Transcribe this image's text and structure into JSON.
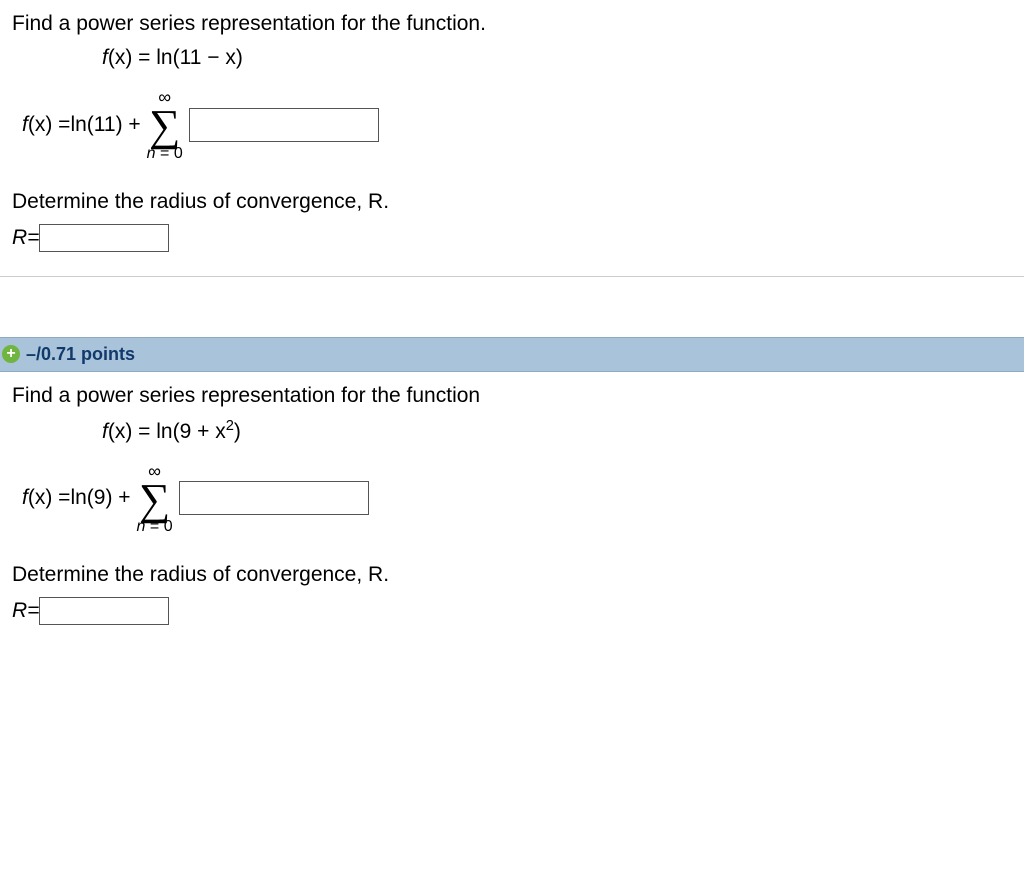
{
  "q1": {
    "prompt": "Find a power series representation for the function.",
    "fn_prefix": "f",
    "fn_arg": "(x) = ",
    "fn_body": "ln(11 − x)",
    "ans_prefix": "f",
    "ans_arg": "(x) = ",
    "ans_body": "ln(11) + ",
    "sum_top": "∞",
    "sum_bottom_var": "n",
    "sum_bottom_rest": " = 0",
    "radius_prompt": "Determine the radius of convergence, R.",
    "r_label": "R",
    "r_eq": " = "
  },
  "bar": {
    "expand": "+",
    "points": "–/0.71 points"
  },
  "q2": {
    "prompt": "Find a power series representation for the function",
    "fn_prefix": "f",
    "fn_arg": "(x) = ",
    "fn_body_a": "ln(9 + x",
    "fn_body_sup": "2",
    "fn_body_b": ")",
    "ans_prefix": "f",
    "ans_arg": "(x) = ",
    "ans_body": "ln(9) + ",
    "sum_top": "∞",
    "sum_bottom_var": "n",
    "sum_bottom_rest": " = 0",
    "radius_prompt": "Determine the radius of convergence, R.",
    "r_label": "R",
    "r_eq": " = "
  }
}
